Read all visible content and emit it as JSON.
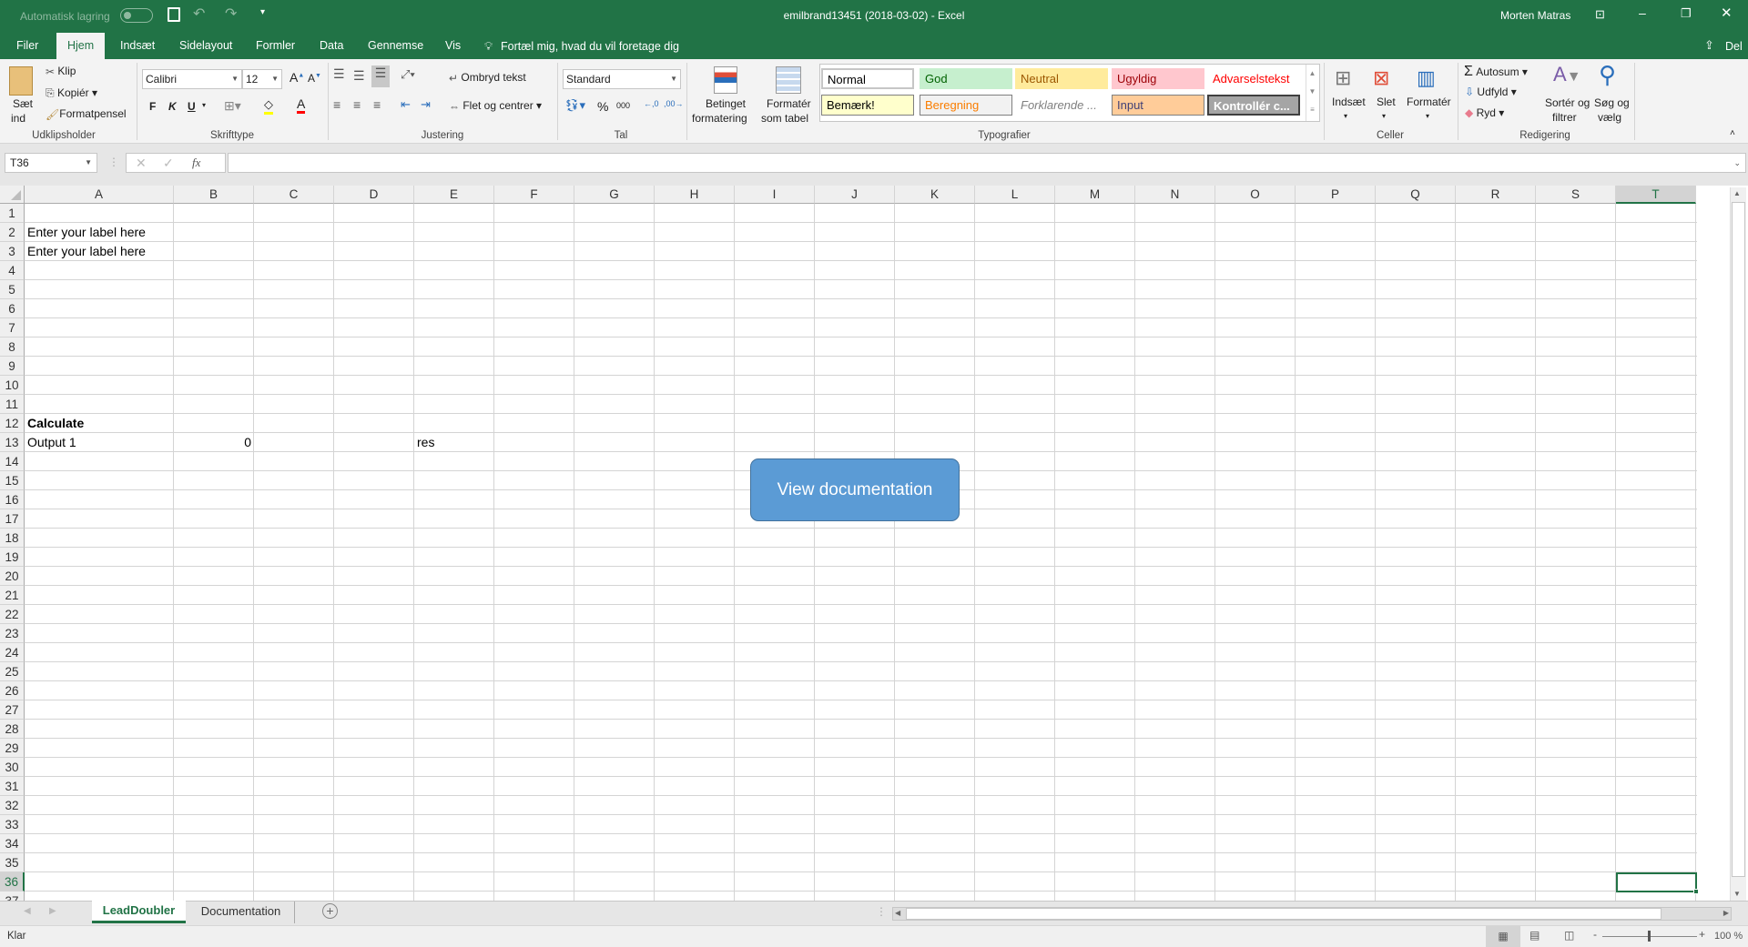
{
  "titlebar": {
    "autosave_label": "Automatisk lagring",
    "title": "emilbrand13451 (2018-03-02)  -  Excel",
    "user": "Morten Matras"
  },
  "tabs": [
    "Filer",
    "Hjem",
    "Indsæt",
    "Sidelayout",
    "Formler",
    "Data",
    "Gennemse",
    "Vis"
  ],
  "active_tab": "Hjem",
  "tell_me": "Fortæl mig, hvad du vil foretage dig",
  "share": "Del",
  "ribbon": {
    "clipboard": {
      "paste1": "Sæt",
      "paste2": "ind",
      "cut": "Klip",
      "copy": "Kopiér",
      "painter": "Formatpensel",
      "label": "Udklipsholder"
    },
    "font": {
      "name": "Calibri",
      "size": "12",
      "bold": "F",
      "italic": "K",
      "underline": "U",
      "label": "Skrifttype"
    },
    "alignment": {
      "wrap": "Ombryd tekst",
      "merge": "Flet og centrer",
      "label": "Justering"
    },
    "number": {
      "format": "Standard",
      "percent": "%",
      "thousands": "000",
      "label": "Tal"
    },
    "styles": {
      "cond1": "Betinget",
      "cond2": "formatering",
      "table1": "Formatér",
      "table2": "som tabel",
      "gallery": [
        {
          "name": "Normal",
          "bg": "#ffffff",
          "fg": "#000000"
        },
        {
          "name": "God",
          "bg": "#c6efce",
          "fg": "#006100"
        },
        {
          "name": "Neutral",
          "bg": "#ffeb9c",
          "fg": "#9c5700"
        },
        {
          "name": "Ugyldig",
          "bg": "#ffc7ce",
          "fg": "#9c0006"
        },
        {
          "name": "Advarselstekst",
          "bg": "#ffffff",
          "fg": "#ff0000"
        },
        {
          "name": "Bemærk!",
          "bg": "#ffffcc",
          "fg": "#000000"
        },
        {
          "name": "Beregning",
          "bg": "#f2f2f2",
          "fg": "#fa7d00"
        },
        {
          "name": "Forklarende ...",
          "bg": "#ffffff",
          "fg": "#7f7f7f"
        },
        {
          "name": "Input",
          "bg": "#ffcc99",
          "fg": "#3f3f76"
        },
        {
          "name": "Kontrollér c...",
          "bg": "#a5a5a5",
          "fg": "#ffffff"
        }
      ],
      "label": "Typografier"
    },
    "cells": {
      "insert": "Indsæt",
      "delete": "Slet",
      "format": "Formatér",
      "label": "Celler"
    },
    "editing": {
      "autosum": "Autosum",
      "fill": "Udfyld",
      "clear": "Ryd",
      "sort1": "Sortér og",
      "sort2": "filtrer",
      "find1": "Søg og",
      "find2": "vælg",
      "label": "Redigering"
    }
  },
  "formula_bar": {
    "name_box": "T36",
    "fx": "fx",
    "value": ""
  },
  "columns": [
    "A",
    "B",
    "C",
    "D",
    "E",
    "F",
    "G",
    "H",
    "I",
    "J",
    "K",
    "L",
    "M",
    "N",
    "O",
    "P",
    "Q",
    "R",
    "S",
    "T"
  ],
  "rows": [
    "1",
    "2",
    "3",
    "4",
    "5",
    "6",
    "7",
    "8",
    "9",
    "10",
    "11",
    "12",
    "13",
    "14",
    "15",
    "16",
    "17",
    "18",
    "19",
    "20",
    "21",
    "22",
    "23",
    "24",
    "25",
    "26",
    "27",
    "28",
    "29",
    "30",
    "31",
    "32",
    "33",
    "34",
    "35",
    "36",
    "37"
  ],
  "cells": {
    "A2": "Enter your label here",
    "A3": "Enter your label here",
    "A12": "Calculate",
    "A13": "Output 1",
    "B13": "0",
    "E13": "res"
  },
  "selected_cell": "T36",
  "doc_button": "View documentation",
  "sheets": [
    "LeadDoubler",
    "Documentation"
  ],
  "active_sheet": "LeadDoubler",
  "status": {
    "mode": "Klar",
    "zoom": "100 %"
  },
  "colors": {
    "brand": "#217346",
    "button": "#5b9bd5"
  }
}
